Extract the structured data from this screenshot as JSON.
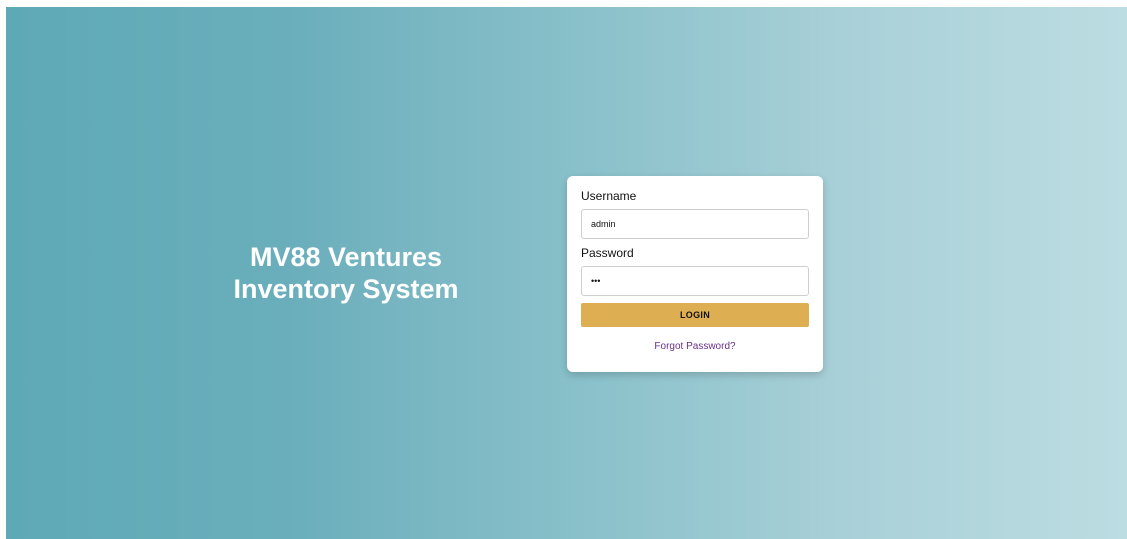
{
  "brand": {
    "line1": "MV88 Ventures",
    "line2": "Inventory System"
  },
  "login_form": {
    "username_label": "Username",
    "username_value": "admin",
    "password_label": "Password",
    "password_value": "123",
    "login_label": "LOGIN",
    "forgot_label": "Forgot Password?"
  },
  "colors": {
    "gradient_start": "#5ea9b6",
    "gradient_end": "#bcdde2",
    "login_button": "#ddaf52",
    "forgot_link": "#6b2f8f",
    "card_background": "#ffffff"
  }
}
